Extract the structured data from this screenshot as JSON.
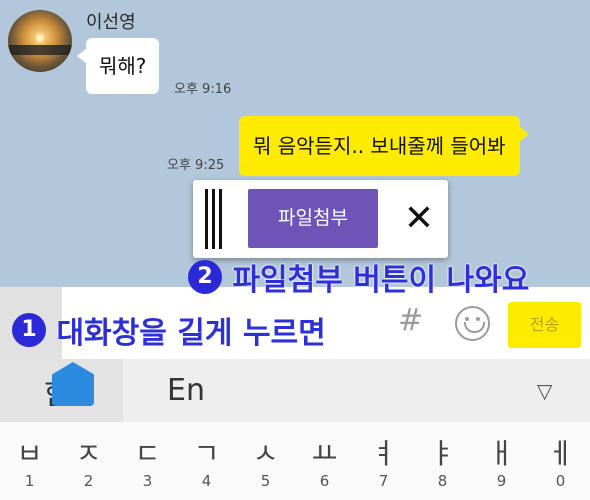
{
  "chat": {
    "sender_name": "이선영",
    "incoming": {
      "text": "뭐해?",
      "time": "오후 9:16"
    },
    "outgoing": {
      "text": "뭐 음악듣지..  보내줄께 들어봐",
      "time": "오후 9:25"
    }
  },
  "popup": {
    "attach_label": "파일첨부",
    "close_glyph": "✕"
  },
  "annotations": {
    "step2": {
      "number": "2",
      "text": "파일첨부 버튼이 나와요"
    },
    "step1": {
      "number": "1",
      "text": "대화창을 길게 누르면"
    }
  },
  "input_bar": {
    "hash_glyph": "#",
    "send_label": "전송"
  },
  "keyboard": {
    "left_lang": "한",
    "lang_label": "En",
    "collapse_glyph": "▽",
    "keys": [
      {
        "char": "ㅂ",
        "num": "1"
      },
      {
        "char": "ㅈ",
        "num": "2"
      },
      {
        "char": "ㄷ",
        "num": "3"
      },
      {
        "char": "ㄱ",
        "num": "4"
      },
      {
        "char": "ㅅ",
        "num": "5"
      },
      {
        "char": "ㅛ",
        "num": "6"
      },
      {
        "char": "ㅕ",
        "num": "7"
      },
      {
        "char": "ㅑ",
        "num": "8"
      },
      {
        "char": "ㅐ",
        "num": "9"
      },
      {
        "char": "ㅔ",
        "num": "0"
      }
    ]
  }
}
